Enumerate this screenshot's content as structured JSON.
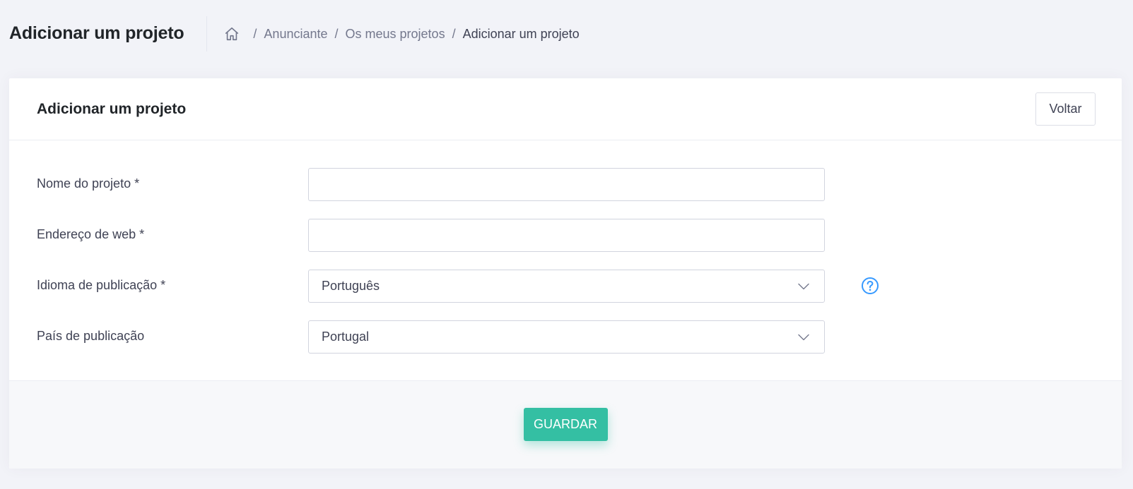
{
  "header": {
    "title": "Adicionar um projeto",
    "breadcrumb": {
      "home_icon": "home-icon",
      "separator": "/",
      "items": [
        "Anunciante",
        "Os meus projetos",
        "Adicionar um projeto"
      ]
    }
  },
  "card": {
    "title": "Adicionar um projeto",
    "back_label": "Voltar"
  },
  "form": {
    "project_name": {
      "label": "Nome do projeto *",
      "value": "",
      "placeholder": ""
    },
    "web_address": {
      "label": "Endereço de web *",
      "value": "",
      "placeholder": ""
    },
    "language": {
      "label": "Idioma de publicação *",
      "selected": "Português",
      "help_icon": "question-circle-icon"
    },
    "country": {
      "label": "País de publicação",
      "selected": "Portugal"
    }
  },
  "footer": {
    "save_label": "GUARDAR"
  },
  "colors": {
    "background": "#f2f3f8",
    "primary_accent": "#34bfa3",
    "help_icon": "#3699ff",
    "text": "#3f4254",
    "muted_text": "#74788d"
  }
}
